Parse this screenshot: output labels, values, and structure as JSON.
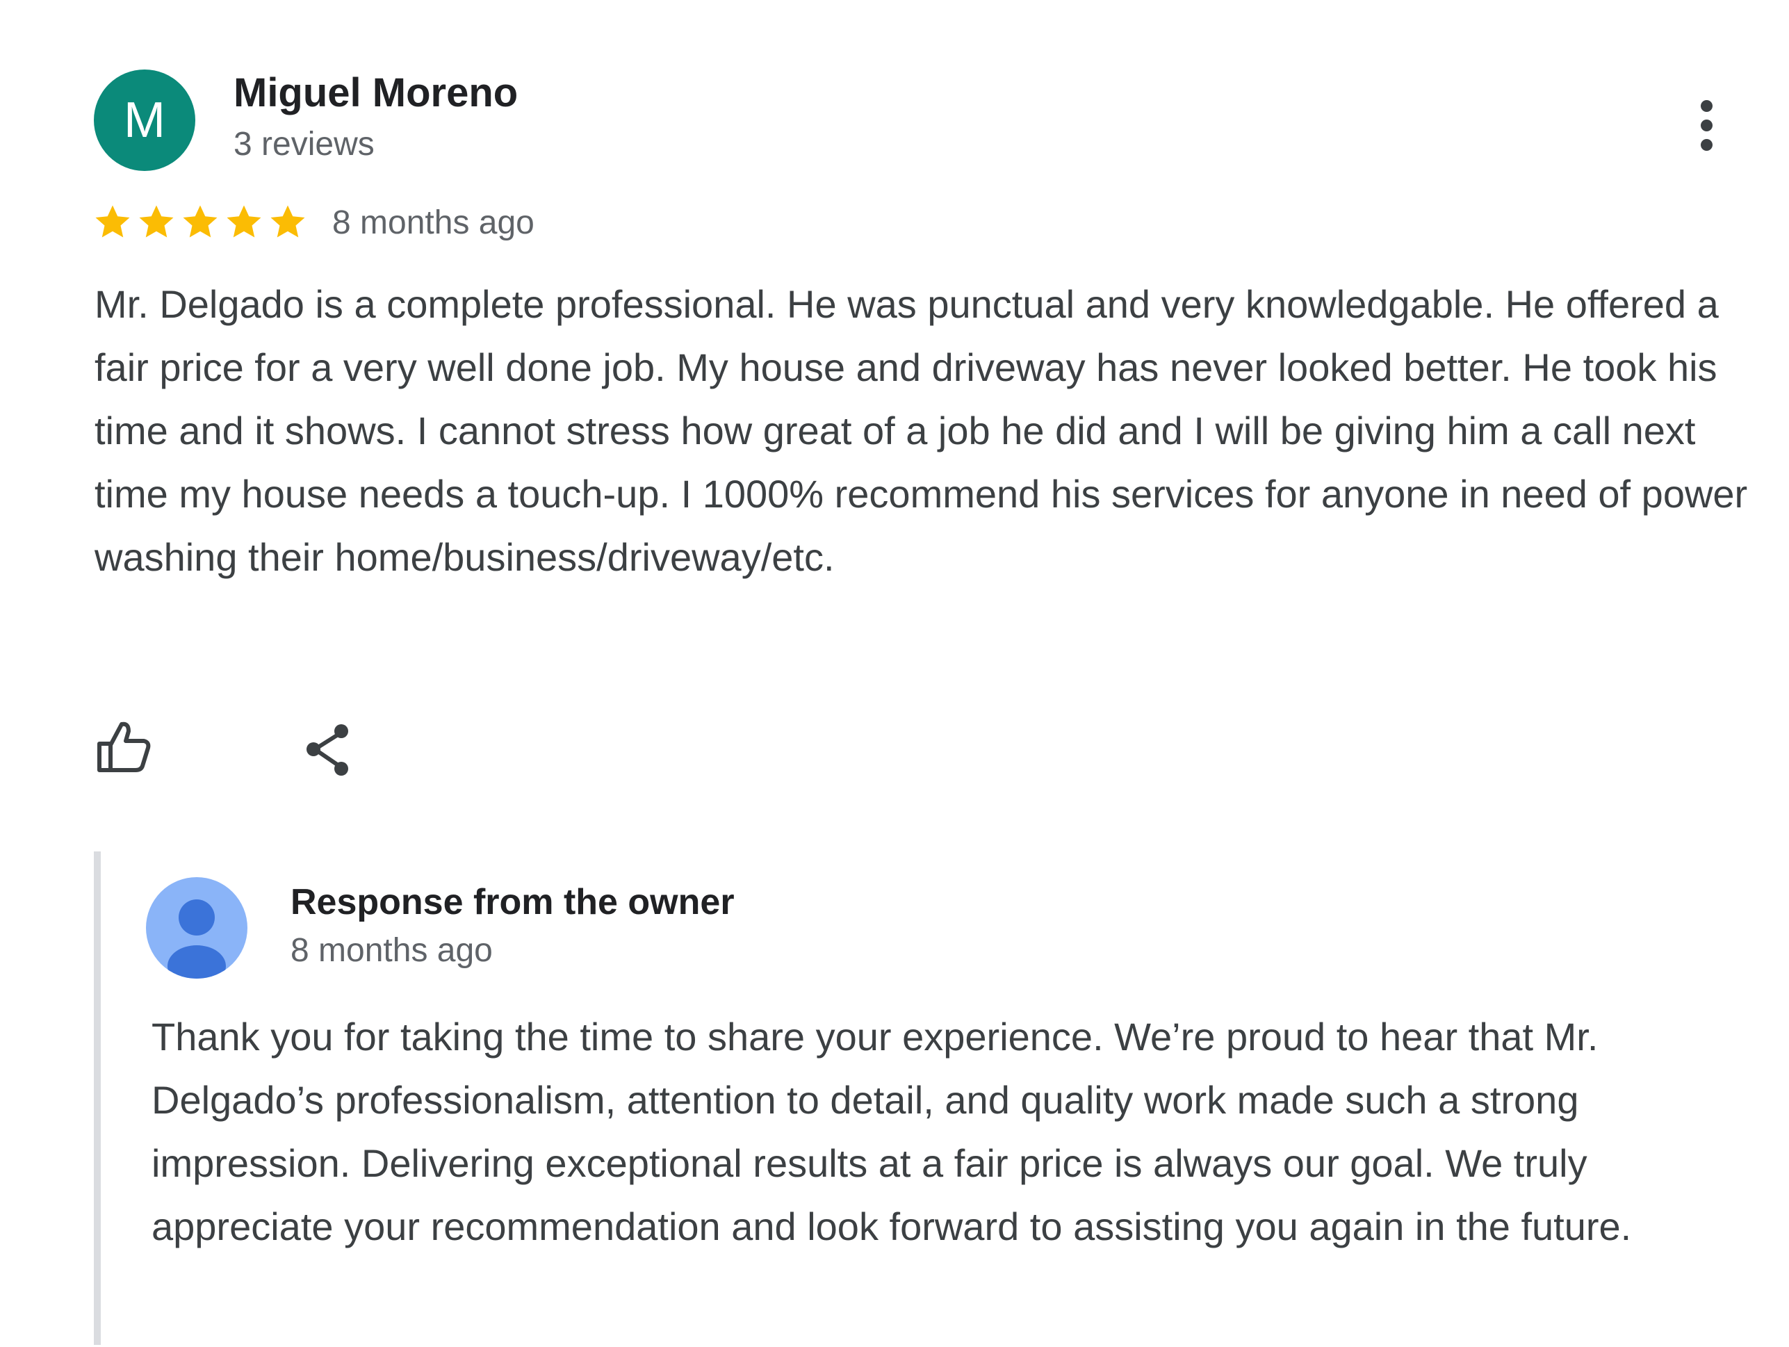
{
  "review": {
    "reviewer": {
      "initial": "M",
      "name": "Miguel Moreno",
      "review_count": "3 reviews",
      "avatar_color": "#0b8a7a"
    },
    "menu_icon": "more-vert-icon",
    "rating": {
      "stars": 5,
      "max_stars": 5,
      "star_color": "#fbbc04"
    },
    "date": "8 months ago",
    "text": "Mr. Delgado is a complete professional. He was punctual and very knowledgable. He offered a fair price for a very well done job. My house and driveway has never looked better. He took his time and it shows. I cannot stress how great of a job he did and I will be giving him a call next time my house needs a touch-up. I 1000% recommend his services for anyone in need of power washing their home/business/driveway/etc.",
    "actions": {
      "like_icon": "thumbs-up-icon",
      "share_icon": "share-icon"
    }
  },
  "owner_response": {
    "title": "Response from the owner",
    "date": "8 months ago",
    "avatar_icon": "person-icon",
    "avatar_color": "#8ab4f8",
    "text": "Thank you for taking the time to share your experience. We’re proud to hear that Mr. Delgado’s professionalism, attention to detail, and quality work made such a strong impression. Delivering exceptional results at a fair price is always our goal. We truly appreciate your recommendation and look forward to assisting you again in the future."
  }
}
